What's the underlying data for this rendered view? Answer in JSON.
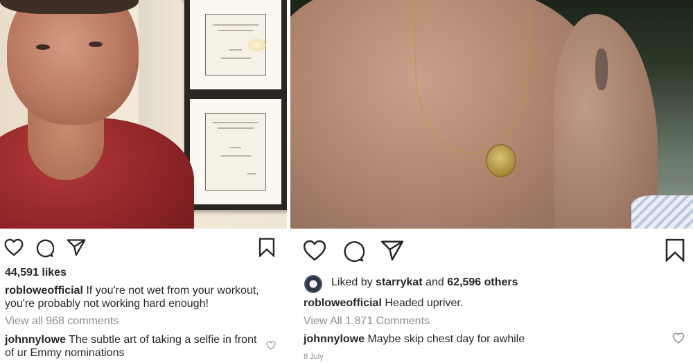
{
  "left_post": {
    "likes": "44,591 likes",
    "caption_user": "robloweofficial",
    "caption_text": "If you're not wet from your workout, you're probably not working hard enough!",
    "view_comments": "View all 968 comments",
    "comment_user": "johnnylowe",
    "comment_text": "The subtle art of taking a selfie in front of ur Emmy nominations"
  },
  "right_post": {
    "liked_by_prefix": "Liked by",
    "liked_by_user": "starrykat",
    "liked_by_mid": "and",
    "liked_by_others": "62,596 others",
    "caption_user": "robloweofficial",
    "caption_text": "Headed upriver.",
    "view_comments": "View All 1,871 Comments",
    "comment_user": "johnnylowe",
    "comment_text": "Maybe skip chest day for awhile",
    "date": "8 July"
  },
  "icons": {
    "like": "heart-icon",
    "comment": "comment-bubble-icon",
    "share": "paper-plane-icon",
    "save": "bookmark-icon",
    "comment_like": "small-heart-icon"
  },
  "colors": {
    "text": "#262626",
    "muted": "#8e8e8e",
    "background": "#ffffff"
  }
}
